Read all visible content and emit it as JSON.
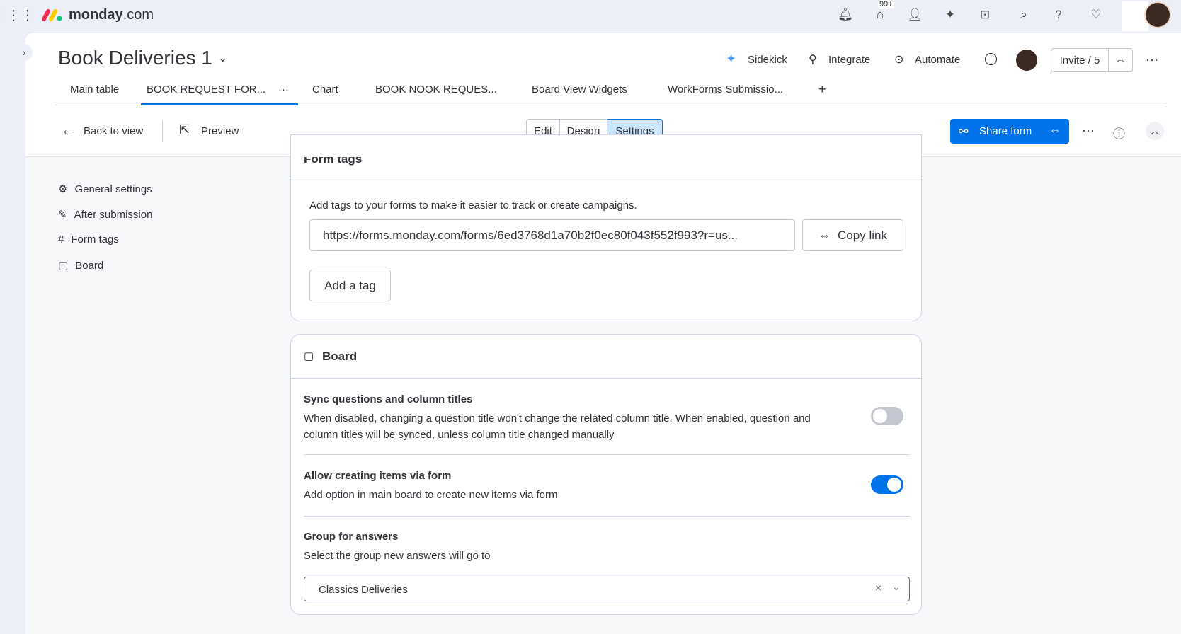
{
  "topbar": {
    "brand": "monday",
    "brand_suffix": ".com",
    "notification_badge": "99+"
  },
  "header": {
    "title": "Book Deliveries 1",
    "sidekick": "Sidekick",
    "integrate": "Integrate",
    "automate": "Automate",
    "invite": "Invite / 5"
  },
  "tabs": [
    {
      "label": "Main table"
    },
    {
      "label": "BOOK REQUEST FOR..."
    },
    {
      "label": "Chart"
    },
    {
      "label": "BOOK NOOK REQUES..."
    },
    {
      "label": "Board View Widgets"
    },
    {
      "label": "WorkForms Submissio..."
    }
  ],
  "tab_more": "···",
  "tab_add": "+",
  "toolbar": {
    "back": "Back to view",
    "preview": "Preview",
    "edit": "Edit",
    "design": "Design",
    "settings": "Settings",
    "share": "Share form"
  },
  "sidebar": {
    "items": [
      {
        "label": "General settings"
      },
      {
        "label": "After submission"
      },
      {
        "label": "Form tags"
      },
      {
        "label": "Board"
      }
    ]
  },
  "form_tags": {
    "title": "Form tags",
    "description": "Add tags to your forms to make it easier to track or create campaigns.",
    "url": "https://forms.monday.com/forms/6ed3768d1a70b2f0ec80f043f552f993?r=us...",
    "copy_link": "Copy link",
    "add_tag": "Add a tag"
  },
  "board": {
    "title": "Board",
    "sync": {
      "title": "Sync questions and column titles",
      "desc1": "When disabled, changing a question title won't change the related column title. When enabled, question and",
      "desc2": "column titles will be synced, unless column title changed manually",
      "enabled": false
    },
    "allow": {
      "title": "Allow creating items via form",
      "desc": "Add option in main board to create new items via form",
      "enabled": true
    },
    "group": {
      "title": "Group for answers",
      "desc": "Select the group new answers will go to",
      "value": "Classics Deliveries"
    }
  },
  "colors": {
    "accent": "#0073ea",
    "toggle_off": "#c5c7d0"
  }
}
